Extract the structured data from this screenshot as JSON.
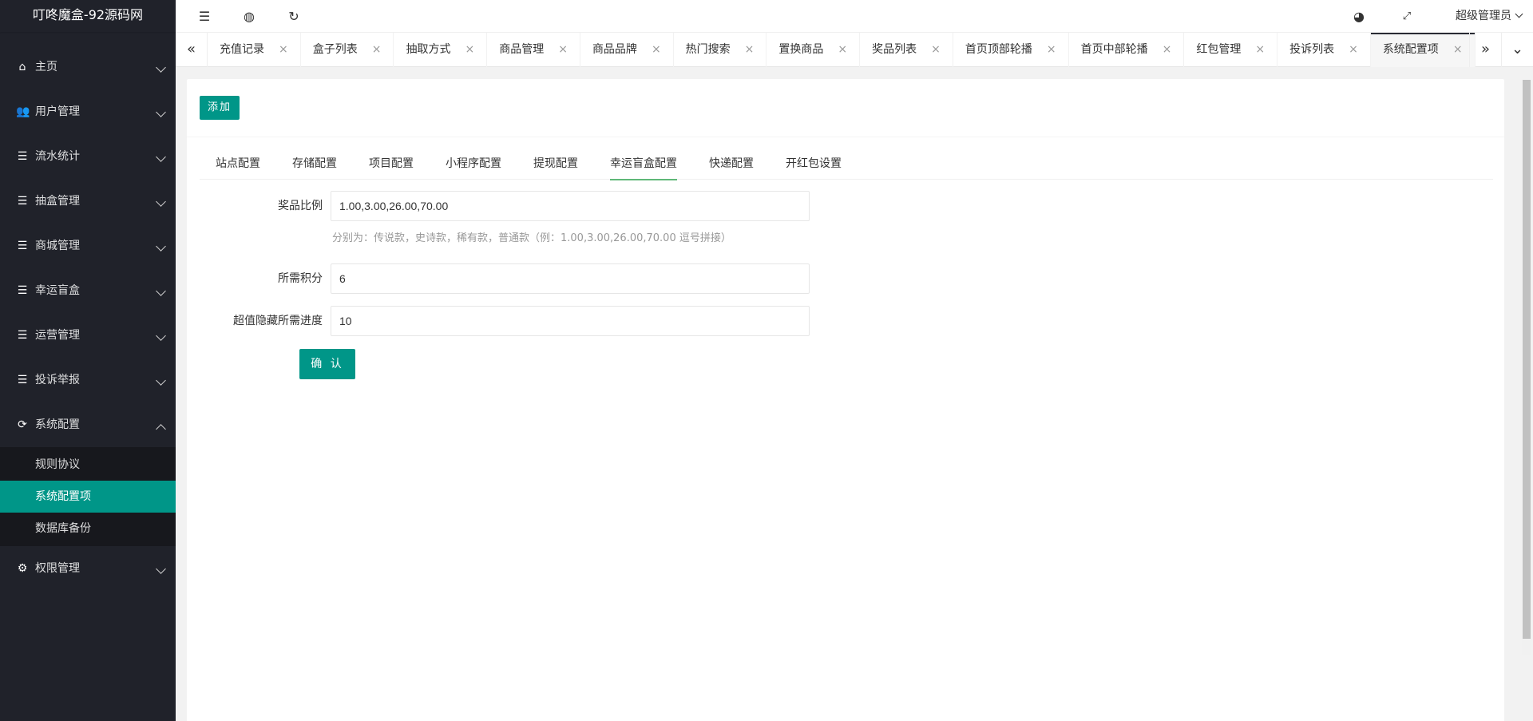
{
  "app": {
    "title": "叮咚魔盒-92源码网"
  },
  "sidebar": {
    "items": [
      {
        "label": "主页",
        "icon": "home-icon"
      },
      {
        "label": "用户管理",
        "icon": "users-icon"
      },
      {
        "label": "流水统计",
        "icon": "list-icon"
      },
      {
        "label": "抽盒管理",
        "icon": "list-icon"
      },
      {
        "label": "商城管理",
        "icon": "list-icon"
      },
      {
        "label": "幸运盲盒",
        "icon": "list-icon"
      },
      {
        "label": "运营管理",
        "icon": "list-icon"
      },
      {
        "label": "投诉举报",
        "icon": "list-icon"
      },
      {
        "label": "系统配置",
        "icon": "settings-icon",
        "expanded": true,
        "children": [
          {
            "label": "规则协议"
          },
          {
            "label": "系统配置项",
            "active": true
          },
          {
            "label": "数据库备份"
          }
        ]
      },
      {
        "label": "权限管理",
        "icon": "gear-icon"
      }
    ]
  },
  "header": {
    "user": "超级管理员"
  },
  "tabs": [
    {
      "label": "充值记录"
    },
    {
      "label": "盒子列表"
    },
    {
      "label": "抽取方式"
    },
    {
      "label": "商品管理"
    },
    {
      "label": "商品品牌"
    },
    {
      "label": "热门搜索"
    },
    {
      "label": "置换商品"
    },
    {
      "label": "奖品列表"
    },
    {
      "label": "首页顶部轮播"
    },
    {
      "label": "首页中部轮播"
    },
    {
      "label": "红包管理"
    },
    {
      "label": "投诉列表"
    },
    {
      "label": "系统配置项",
      "active": true
    }
  ],
  "content": {
    "add_button": "添加",
    "config_tabs": [
      {
        "label": "站点配置"
      },
      {
        "label": "存储配置"
      },
      {
        "label": "项目配置"
      },
      {
        "label": "小程序配置"
      },
      {
        "label": "提现配置"
      },
      {
        "label": "幸运盲盒配置",
        "active": true
      },
      {
        "label": "快递配置"
      },
      {
        "label": "开红包设置"
      }
    ],
    "form": {
      "prize_ratio_label": "奖品比例",
      "prize_ratio_value": "1.00,3.00,26.00,70.00",
      "prize_ratio_tip": "分别为：传说款，史诗款，稀有款，普通款（例：1.00,3.00,26.00,70.00 逗号拼接）",
      "points_label": "所需积分",
      "points_value": "6",
      "hidden_label": "超值隐藏所需进度",
      "hidden_value": "10",
      "confirm_button": "确 认"
    }
  },
  "colors": {
    "accent": "#009688",
    "sidebar_bg": "#20222a",
    "tab_underline": "#5fb878"
  }
}
